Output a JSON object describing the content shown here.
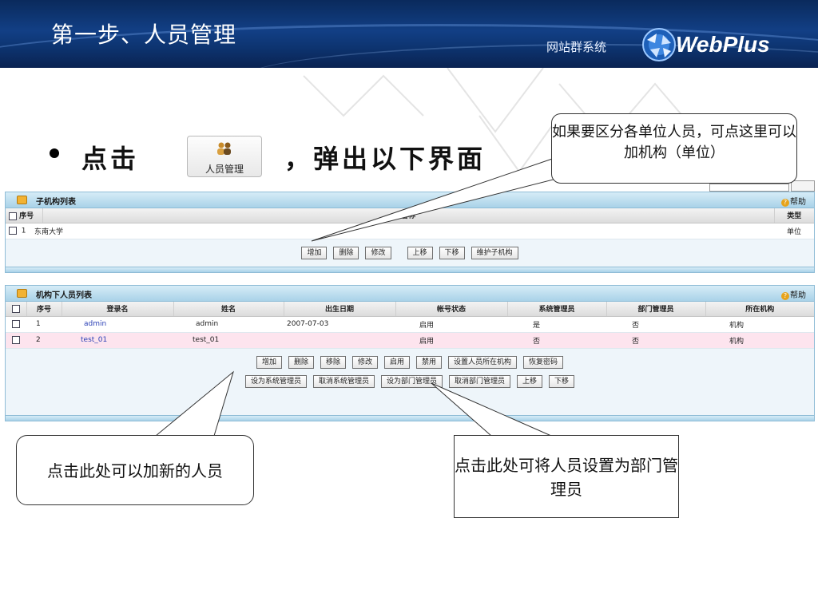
{
  "header": {
    "title": "第一步、人员管理",
    "brand_sub": "网站群系统",
    "brand_name": "WebPlus"
  },
  "bullet": {
    "prefix": "点击",
    "suffix": "，弹出以下界面",
    "button_label": "人员管理"
  },
  "callouts": {
    "top": "如果要区分各单位人员，可点这里可以加机构（单位）",
    "left": "点击此处可以加新的人员",
    "right": "点击此处可将人员设置为部门管理员"
  },
  "panel1": {
    "title": "子机构列表",
    "help": "帮助",
    "columns": [
      "序号",
      "名称",
      "类型"
    ],
    "rows": [
      {
        "index": "1",
        "name": "东南大学",
        "type": "单位"
      }
    ],
    "buttons": [
      "增加",
      "删除",
      "修改",
      "上移",
      "下移",
      "维护子机构"
    ]
  },
  "panel2": {
    "title": "机构下人员列表",
    "help": "帮助",
    "columns": [
      "序号",
      "登录名",
      "姓名",
      "出生日期",
      "帐号状态",
      "系统管理员",
      "部门管理员",
      "所在机构"
    ],
    "rows": [
      {
        "index": "1",
        "login": "admin",
        "name": "admin",
        "birth": "2007-07-03",
        "status": "启用",
        "sysadmin": "是",
        "deptadmin": "否",
        "org": "机构"
      },
      {
        "index": "2",
        "login": "test_01",
        "name": "test_01",
        "birth": "",
        "status": "启用",
        "sysadmin": "否",
        "deptadmin": "否",
        "org": "机构"
      }
    ],
    "buttons_row1": [
      "增加",
      "删除",
      "移除",
      "修改",
      "启用",
      "禁用",
      "设置人员所在机构",
      "恢复密码"
    ],
    "buttons_row2": [
      "设为系统管理员",
      "取消系统管理员",
      "设为部门管理员",
      "取消部门管理员",
      "上移",
      "下移"
    ]
  },
  "colors": {
    "banner": "#123f85",
    "panel_border": "#8fbcd6",
    "pink_row": "#fde4ee",
    "link": "#2a3fb5"
  }
}
